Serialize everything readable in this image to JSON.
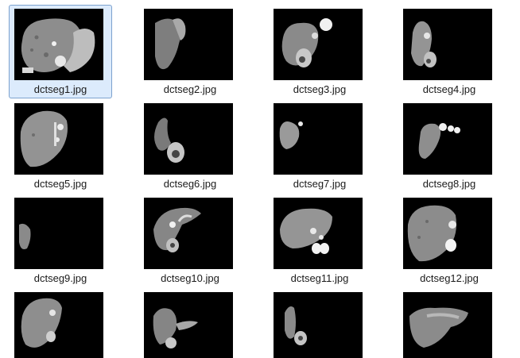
{
  "files": [
    {
      "name": "dctseg1.jpg",
      "icon": "liver-ct-slice-thumbnail",
      "selected": true
    },
    {
      "name": "dctseg2.jpg",
      "icon": "liver-ct-slice-thumbnail",
      "selected": false
    },
    {
      "name": "dctseg3.jpg",
      "icon": "liver-ct-slice-thumbnail",
      "selected": false
    },
    {
      "name": "dctseg4.jpg",
      "icon": "liver-ct-slice-thumbnail",
      "selected": false
    },
    {
      "name": "dctseg5.jpg",
      "icon": "liver-ct-slice-thumbnail",
      "selected": false
    },
    {
      "name": "dctseg6.jpg",
      "icon": "liver-ct-slice-thumbnail",
      "selected": false
    },
    {
      "name": "dctseg7.jpg",
      "icon": "liver-ct-slice-thumbnail",
      "selected": false
    },
    {
      "name": "dctseg8.jpg",
      "icon": "liver-ct-slice-thumbnail",
      "selected": false
    },
    {
      "name": "dctseg9.jpg",
      "icon": "liver-ct-slice-thumbnail",
      "selected": false
    },
    {
      "name": "dctseg10.jpg",
      "icon": "liver-ct-slice-thumbnail",
      "selected": false
    },
    {
      "name": "dctseg11.jpg",
      "icon": "liver-ct-slice-thumbnail",
      "selected": false
    },
    {
      "name": "dctseg12.jpg",
      "icon": "liver-ct-slice-thumbnail",
      "selected": false
    },
    {
      "name": "",
      "icon": "liver-ct-slice-thumbnail",
      "selected": false
    },
    {
      "name": "",
      "icon": "liver-ct-slice-thumbnail",
      "selected": false
    },
    {
      "name": "",
      "icon": "liver-ct-slice-thumbnail",
      "selected": false
    },
    {
      "name": "",
      "icon": "liver-ct-slice-thumbnail",
      "selected": false
    }
  ],
  "colors": {
    "selection_bg": "#dcebfc",
    "selection_border": "#7da2ce",
    "thumb_bg": "#000000"
  }
}
